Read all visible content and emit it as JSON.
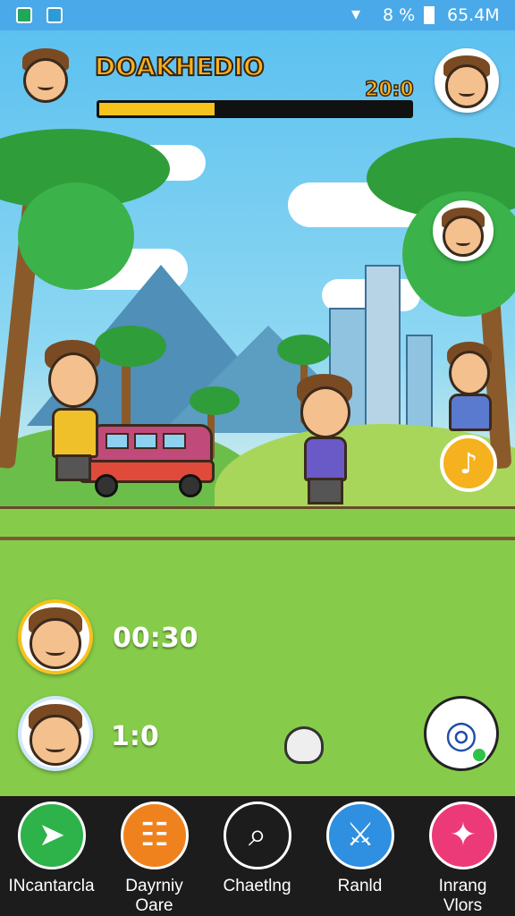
{
  "status_bar": {
    "signal_text": "8 %",
    "memory_text": "65.4M",
    "wifi_icon": "wifi-icon",
    "battery_icon": "battery-icon"
  },
  "hud": {
    "title": "DOAKHEDIO",
    "score": "20:0",
    "progress": 0.37,
    "timer": "00:30",
    "match_score": "1:0"
  },
  "nav": {
    "items": [
      {
        "label": "INcantarcla",
        "icon": "send-arrow-icon",
        "color": "#2eb24a"
      },
      {
        "label": "Dayrniy\nOare",
        "icon": "lantern-icon",
        "color": "#f0821e"
      },
      {
        "label": "Chaetlng",
        "icon": "search-pin-icon",
        "color": "#1c1c1c"
      },
      {
        "label": "Ranld",
        "icon": "crossed-swords-icon",
        "color": "#2f8fe0"
      },
      {
        "label": "Inrang\nVlors",
        "icon": "puzzle-icon",
        "color": "#ec3a78"
      }
    ]
  },
  "colors": {
    "accent": "#f5b21e",
    "sky": "#5cc1f0",
    "grass": "#86cc4a"
  }
}
